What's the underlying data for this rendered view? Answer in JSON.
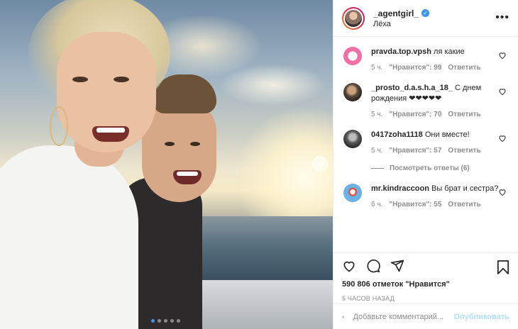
{
  "post": {
    "username": "_agentgirl_",
    "location": "Лёха",
    "carousel_total": 5,
    "carousel_active": 0
  },
  "comments": [
    {
      "user": "pravda.top.vpsh",
      "text": "ля какие ",
      "time": "5 ч.",
      "likes": "\"Нравится\": 99",
      "reply": "Ответить",
      "avatar_color": "#f06fa6"
    },
    {
      "user": "_prosto_d.a.s.h.a_18_",
      "text": "С днем рождения ❤❤❤❤❤",
      "time": "5 ч.",
      "likes": "\"Нравится\": 70",
      "reply": "Ответить",
      "avatar_color": "#6b5b4b"
    },
    {
      "user": "0417zoha1118",
      "text": "Они вместе!",
      "time": "5 ч.",
      "likes": "\"Нравится\": 57",
      "reply": "Ответить",
      "avatar_color": "#4a4a4a"
    },
    {
      "user": "mr.kindraccoon",
      "text": "Вы брат и сестра? ",
      "time": "6 ч.",
      "likes": "\"Нравится\": 55",
      "reply": "Ответить",
      "avatar_color": "#6bb3e6"
    }
  ],
  "view_replies": "Посмотреть ответы (6)",
  "likes_text": "590 806 отметок \"Нравится\"",
  "time_ago": "5 ЧАСОВ НАЗАД",
  "comment_input": {
    "placeholder": "Добавьте комментарий...",
    "value": ""
  },
  "publish_label": "Опубликовать",
  "colors": {
    "accent": "#3897f0",
    "publish_disabled": "#b2dffc",
    "muted": "#8e8e8e"
  }
}
